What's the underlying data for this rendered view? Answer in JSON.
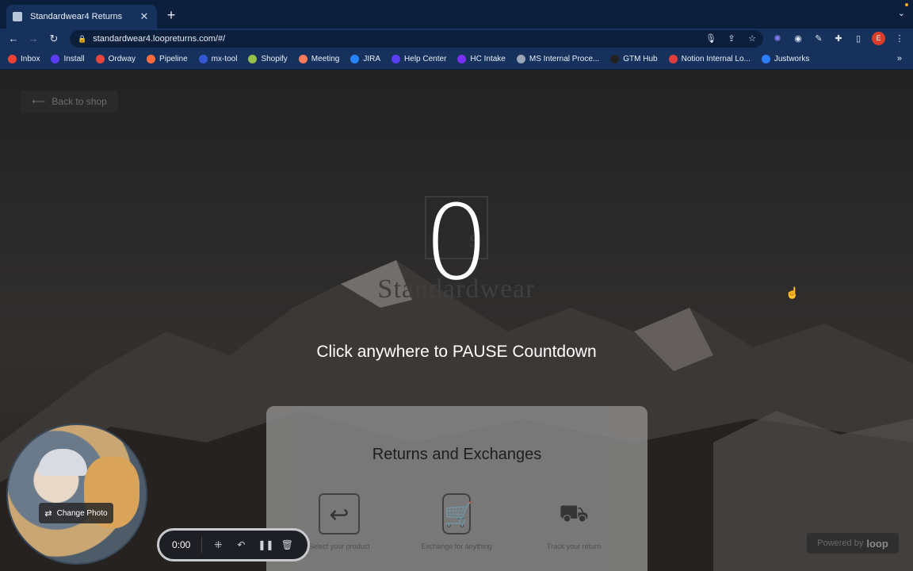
{
  "browser": {
    "tab_title": "Standardwear4 Returns",
    "tab_close": "✕",
    "new_tab": "+",
    "tab_menu": "⌄",
    "url": "standardwear4.loopreturns.com/#/",
    "profile_initial": "E",
    "bookmarks": [
      {
        "label": "Inbox",
        "color": "#ea4335"
      },
      {
        "label": "Install",
        "color": "#5b3df5"
      },
      {
        "label": "Ordway",
        "color": "#e8453c"
      },
      {
        "label": "Pipeline",
        "color": "#ff6b3d"
      },
      {
        "label": "mx-tool",
        "color": "#3457d5"
      },
      {
        "label": "Shopify",
        "color": "#95bf47"
      },
      {
        "label": "Meeting",
        "color": "#ff7a59"
      },
      {
        "label": "JIRA",
        "color": "#2684ff"
      },
      {
        "label": "Help Center",
        "color": "#5b3df5"
      },
      {
        "label": "HC Intake",
        "color": "#7b2ff7"
      },
      {
        "label": "MS Internal Proce...",
        "color": "#9aa5b5"
      },
      {
        "label": "GTM Hub",
        "color": "#222222"
      },
      {
        "label": "Notion Internal Lo...",
        "color": "#e03e3e"
      },
      {
        "label": "Justworks",
        "color": "#2d7ff9"
      }
    ],
    "bookmarks_more": "»"
  },
  "page": {
    "back_label": "Back to shop",
    "logo_text": "Standardwear",
    "logo_mark": "S",
    "countdown": "0",
    "pause_message": "Click anywhere to PAUSE Countdown",
    "card_title": "Returns and Exchanges",
    "steps": [
      {
        "label": "Select your product",
        "icon": "box-return-icon"
      },
      {
        "label": "Exchange for anything",
        "icon": "phone-cart-icon"
      },
      {
        "label": "Track your return",
        "icon": "truck-icon"
      }
    ],
    "powered_prefix": "Powered by",
    "powered_brand": "loop"
  },
  "recorder": {
    "change_photo": "Change Photo",
    "time": "0:00"
  }
}
